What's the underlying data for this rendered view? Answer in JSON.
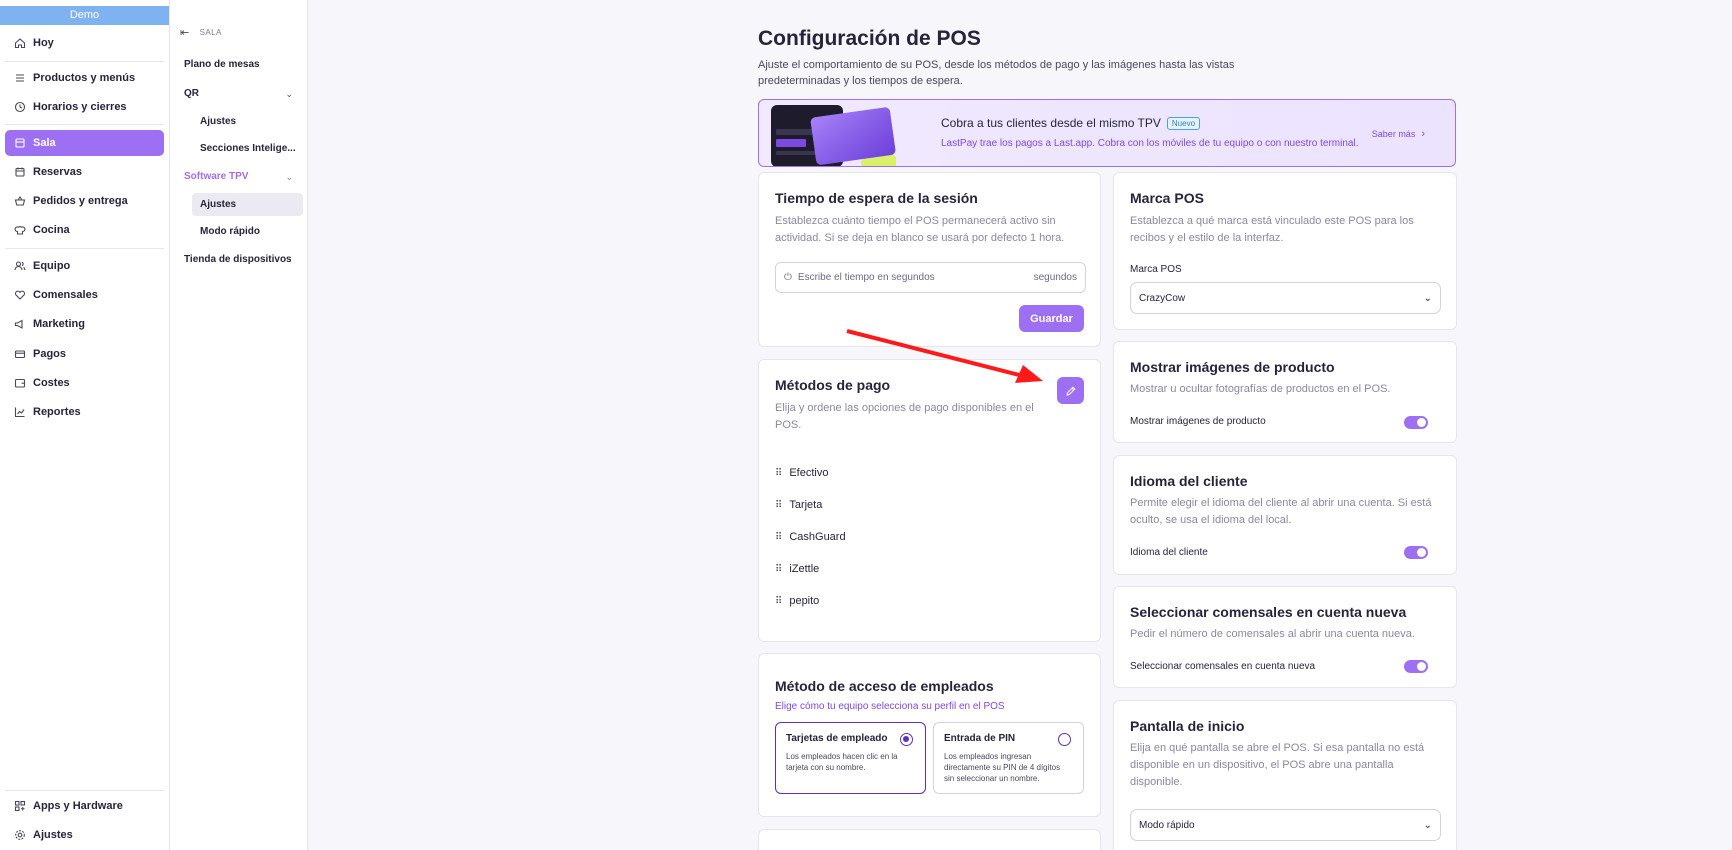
{
  "app": {
    "org": "Demo"
  },
  "sidebar": {
    "items": [
      {
        "label": "Hoy",
        "icon": "home-icon"
      },
      {
        "label": "Productos y menús",
        "icon": "list-icon"
      },
      {
        "label": "Horarios y cierres",
        "icon": "clock-icon"
      },
      {
        "label": "Sala",
        "icon": "table-icon",
        "active": true
      },
      {
        "label": "Reservas",
        "icon": "calendar-icon"
      },
      {
        "label": "Pedidos y entrega",
        "icon": "basket-icon"
      },
      {
        "label": "Cocina",
        "icon": "chef-hat-icon"
      },
      {
        "label": "Equipo",
        "icon": "users-icon"
      },
      {
        "label": "Comensales",
        "icon": "heart-icon"
      },
      {
        "label": "Marketing",
        "icon": "megaphone-icon"
      },
      {
        "label": "Pagos",
        "icon": "card-icon"
      },
      {
        "label": "Costes",
        "icon": "wallet-icon"
      },
      {
        "label": "Reportes",
        "icon": "chart-icon"
      }
    ],
    "bottom": [
      {
        "label": "Apps y Hardware",
        "icon": "apps-icon"
      },
      {
        "label": "Ajustes",
        "icon": "gear-icon"
      }
    ]
  },
  "subsidebar": {
    "header": "SALA",
    "plano": "Plano de mesas",
    "qr": "QR",
    "qr_children": [
      "Ajustes",
      "Secciones Intelige..."
    ],
    "software": "Software TPV",
    "software_children": [
      "Ajustes",
      "Modo rápido"
    ],
    "tienda": "Tienda de dispositivos"
  },
  "main": {
    "title": "Configuración de POS",
    "subtitle": "Ajuste el comportamiento de su POS, desde los métodos de pago y las imágenes hasta las vistas predeterminadas y los tiempos de espera.",
    "banner": {
      "title": "Cobra a tus clientes desde el mismo TPV",
      "badge": "Nuevo",
      "text": "LastPay trae los pagos a Last.app. Cobra con los móviles de tu equipo o con nuestro terminal.",
      "link": "Saber más"
    },
    "timeout": {
      "title": "Tiempo de espera de la sesión",
      "desc": "Establezca cuánto tiempo el POS permanecerá activo sin actividad. Si se deja en blanco se usará por defecto 1 hora.",
      "placeholder": "Escribe el tiempo en segundos",
      "unit": "segundos",
      "save": "Guardar"
    },
    "payments": {
      "title": "Métodos de pago",
      "desc": "Elija y ordene las opciones de pago disponibles en el POS.",
      "items": [
        "Efectivo",
        "Tarjeta",
        "CashGuard",
        "iZettle",
        "pepito"
      ]
    },
    "access": {
      "title": "Método de acceso de empleados",
      "desc": "Elige cómo tu equipo selecciona su perfil en el POS",
      "options": [
        {
          "title": "Tarjetas de empleado",
          "desc": "Los empleados hacen clic en la tarjeta con su nombre."
        },
        {
          "title": "Entrada de PIN",
          "desc": "Los empleados ingresan directamente su PIN de 4 dígitos sin seleccionar un nombre."
        }
      ]
    },
    "brand": {
      "title": "Marca POS",
      "desc": "Establezca a qué marca está vinculado este POS para los recibos y el estilo de la interfaz.",
      "label": "Marca POS",
      "value": "CrazyCow"
    },
    "images": {
      "title": "Mostrar imágenes de producto",
      "desc": "Mostrar u ocultar fotografías de productos en el POS.",
      "label": "Mostrar imágenes de producto"
    },
    "language": {
      "title": "Idioma del cliente",
      "desc": "Permite elegir el idioma del cliente al abrir una cuenta. Si está oculto, se usa el idioma del local.",
      "label": "Idioma del cliente"
    },
    "diners": {
      "title": "Seleccionar comensales en cuenta nueva",
      "desc": "Pedir el número de comensales al abrir una cuenta nueva.",
      "label": "Seleccionar comensales en cuenta nueva"
    },
    "home": {
      "title": "Pantalla de inicio",
      "desc": "Elija en qué pantalla se abre el POS. Si esa pantalla no está disponible en un dispositivo, el POS abre una pantalla disponible.",
      "value": "Modo rápido"
    }
  },
  "colors": {
    "accent": "#9d6ff3",
    "annotation_arrow": "#ff1a1a"
  }
}
